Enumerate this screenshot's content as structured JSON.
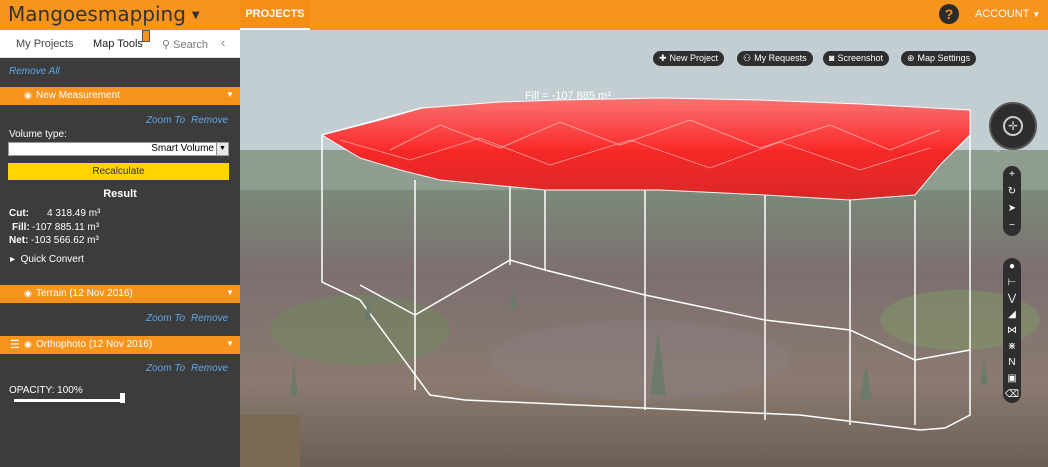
{
  "app": {
    "title": "Mangoesmapping",
    "nav_projects": "PROJECTS",
    "account": "ACCOUNT",
    "help": "?"
  },
  "sidebar": {
    "tabs": {
      "my_projects": "My Projects",
      "map_tools": "Map Tools",
      "search": "Search",
      "collapse": "‹"
    },
    "remove_all": "Remove All",
    "measurement": {
      "title": "New Measurement",
      "zoom_to": "Zoom To",
      "remove": "Remove",
      "volume_type_label": "Volume type:",
      "volume_type_value": "Smart Volume",
      "recalculate": "Recalculate",
      "result_title": "Result",
      "cut_label": "Cut:",
      "cut_value": "4 318.49 m³",
      "fill_label": "Fill:",
      "fill_value": "-107 885.11 m³",
      "net_label": "Net:",
      "net_value": "-103 566.62 m³",
      "quick_convert": "Quick Convert"
    },
    "terrain": {
      "title": "Terrain (12 Nov 2016)",
      "zoom_to": "Zoom To",
      "remove": "Remove"
    },
    "orthophoto": {
      "title": "Orthophoto (12 Nov 2016)",
      "zoom_to": "Zoom To",
      "remove": "Remove",
      "opacity_label": "OPACITY: 100%",
      "opacity": 1.0
    }
  },
  "map": {
    "buttons": {
      "new_project": "New Project",
      "my_requests": "My Requests",
      "screenshot": "Screenshot",
      "map_settings": "Map Settings"
    },
    "fill_label": "Fill = -107 885 m³",
    "compass_n": "N"
  },
  "colors": {
    "accent": "#f7941d",
    "sidebar_bg": "#3c3c3c",
    "link": "#5fa7e6",
    "button_yellow": "#ffd400",
    "fill_red": "#ff2a2a"
  }
}
